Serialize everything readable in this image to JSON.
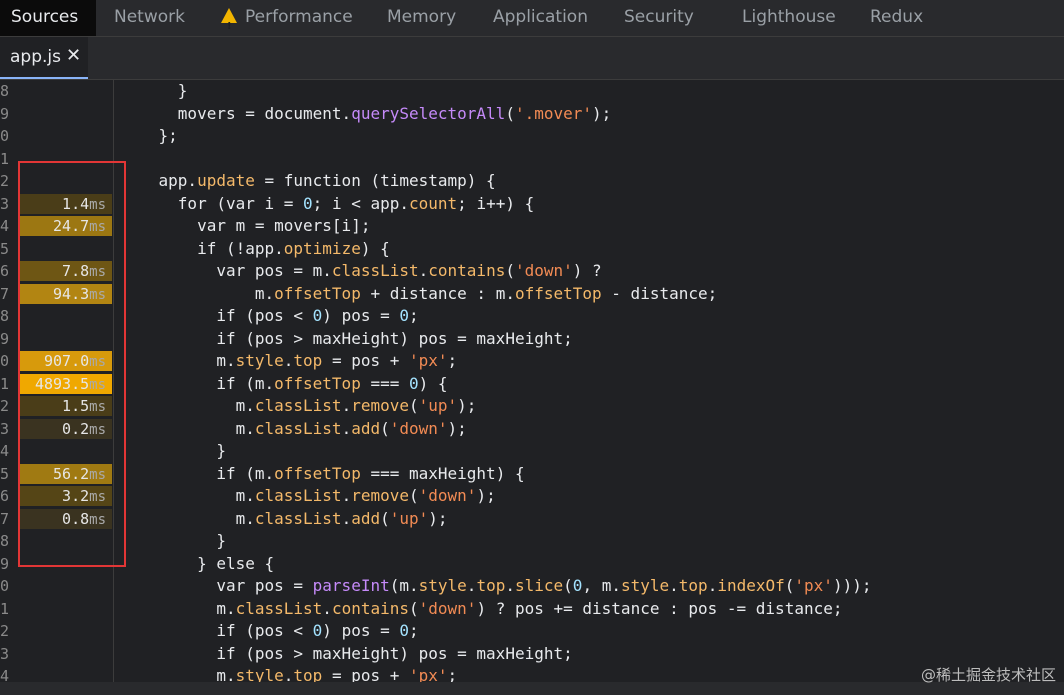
{
  "tabs": [
    {
      "label": "Sources",
      "active": true
    },
    {
      "label": "Network"
    },
    {
      "label": "Performance",
      "icon": "warning-icon"
    },
    {
      "label": "Memory"
    },
    {
      "label": "Application"
    },
    {
      "label": "Security"
    },
    {
      "label": "Lighthouse"
    },
    {
      "label": "Redux"
    }
  ],
  "file_tab": {
    "label": "app.js",
    "close": "✕"
  },
  "line_numbers": [
    "8",
    "9",
    "0",
    "1",
    "2",
    "3",
    "4",
    "5",
    "6",
    "7",
    "8",
    "9",
    "0",
    "1",
    "2",
    "3",
    "4",
    "5",
    "6",
    "7",
    "8",
    "9",
    "0",
    "1",
    "2",
    "3",
    "4"
  ],
  "perf_entries": [
    {
      "row": 5,
      "value": "1.4",
      "unit": "ms",
      "color": "#4a3d18"
    },
    {
      "row": 6,
      "value": "24.7",
      "unit": "ms",
      "color": "#9c7712"
    },
    {
      "row": 8,
      "value": "7.8",
      "unit": "ms",
      "color": "#6e5614"
    },
    {
      "row": 9,
      "value": "94.3",
      "unit": "ms",
      "color": "#b28512"
    },
    {
      "row": 12,
      "value": "907.0",
      "unit": "ms",
      "color": "#d79a0c"
    },
    {
      "row": 13,
      "value": "4893.5",
      "unit": "ms",
      "color": "#f0a800"
    },
    {
      "row": 14,
      "value": "1.5",
      "unit": "ms",
      "color": "#4a3d18"
    },
    {
      "row": 15,
      "value": "0.2",
      "unit": "ms",
      "color": "#3a3320"
    },
    {
      "row": 17,
      "value": "56.2",
      "unit": "ms",
      "color": "#a07a12"
    },
    {
      "row": 18,
      "value": "3.2",
      "unit": "ms",
      "color": "#554516"
    },
    {
      "row": 19,
      "value": "0.8",
      "unit": "ms",
      "color": "#3a3320"
    }
  ],
  "code_lines": [
    "      }",
    "      movers = document.querySelectorAll('.mover');",
    "    };",
    "",
    "    app.update = function (timestamp) {",
    "      for (var i = 0; i < app.count; i++) {",
    "        var m = movers[i];",
    "        if (!app.optimize) {",
    "          var pos = m.classList.contains('down') ?",
    "              m.offsetTop + distance : m.offsetTop - distance;",
    "          if (pos < 0) pos = 0;",
    "          if (pos > maxHeight) pos = maxHeight;",
    "          m.style.top = pos + 'px';",
    "          if (m.offsetTop === 0) {",
    "            m.classList.remove('up');",
    "            m.classList.add('down');",
    "          }",
    "          if (m.offsetTop === maxHeight) {",
    "            m.classList.remove('down');",
    "            m.classList.add('up');",
    "          }",
    "        } else {",
    "          var pos = parseInt(m.style.top.slice(0, m.style.top.indexOf('px')));",
    "          m.classList.contains('down') ? pos += distance : pos -= distance;",
    "          if (pos < 0) pos = 0;",
    "          if (pos > maxHeight) pos = maxHeight;",
    "          m.style.top = pos + 'px';"
  ],
  "watermark": "@稀土掘金技术社区",
  "colors": {
    "highlight_box": "#e23636",
    "accent_tab": "#8ab4f8"
  }
}
